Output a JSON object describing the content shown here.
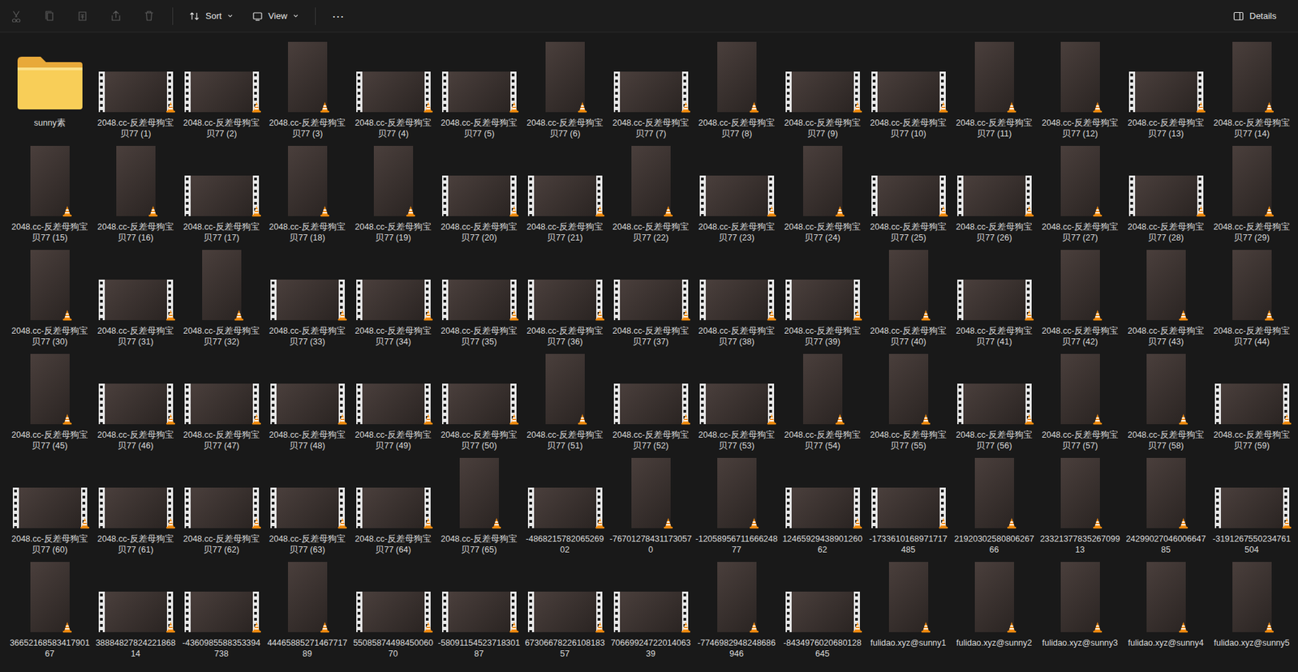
{
  "toolbar": {
    "actions": [
      {
        "disabled": true
      },
      {
        "disabled": true
      },
      {
        "disabled": true
      },
      {
        "disabled": true
      },
      {
        "disabled": true
      }
    ],
    "sort": {
      "label": "Sort"
    },
    "view": {
      "label": "View"
    },
    "more": "⋯",
    "details": {
      "label": "Details"
    }
  },
  "items": [
    {
      "name": "sunny素",
      "kind": "folder"
    },
    {
      "name": "2048.cc-反差母狗宝贝77 (1)",
      "kind": "landscape"
    },
    {
      "name": "2048.cc-反差母狗宝贝77 (2)",
      "kind": "landscape"
    },
    {
      "name": "2048.cc-反差母狗宝贝77 (3)",
      "kind": "portrait"
    },
    {
      "name": "2048.cc-反差母狗宝贝77 (4)",
      "kind": "landscape"
    },
    {
      "name": "2048.cc-反差母狗宝贝77 (5)",
      "kind": "landscape"
    },
    {
      "name": "2048.cc-反差母狗宝贝77 (6)",
      "kind": "portrait"
    },
    {
      "name": "2048.cc-反差母狗宝贝77 (7)",
      "kind": "landscape"
    },
    {
      "name": "2048.cc-反差母狗宝贝77 (8)",
      "kind": "portrait"
    },
    {
      "name": "2048.cc-反差母狗宝贝77 (9)",
      "kind": "landscape"
    },
    {
      "name": "2048.cc-反差母狗宝贝77 (10)",
      "kind": "landscape"
    },
    {
      "name": "2048.cc-反差母狗宝贝77 (11)",
      "kind": "portrait"
    },
    {
      "name": "2048.cc-反差母狗宝贝77 (12)",
      "kind": "portrait"
    },
    {
      "name": "2048.cc-反差母狗宝贝77 (13)",
      "kind": "landscape"
    },
    {
      "name": "2048.cc-反差母狗宝贝77 (14)",
      "kind": "portrait"
    },
    {
      "name": "2048.cc-反差母狗宝贝77 (15)",
      "kind": "portrait"
    },
    {
      "name": "2048.cc-反差母狗宝贝77 (16)",
      "kind": "portrait"
    },
    {
      "name": "2048.cc-反差母狗宝贝77 (17)",
      "kind": "landscape"
    },
    {
      "name": "2048.cc-反差母狗宝贝77 (18)",
      "kind": "portrait"
    },
    {
      "name": "2048.cc-反差母狗宝贝77 (19)",
      "kind": "portrait"
    },
    {
      "name": "2048.cc-反差母狗宝贝77 (20)",
      "kind": "landscape"
    },
    {
      "name": "2048.cc-反差母狗宝贝77 (21)",
      "kind": "landscape"
    },
    {
      "name": "2048.cc-反差母狗宝贝77 (22)",
      "kind": "portrait"
    },
    {
      "name": "2048.cc-反差母狗宝贝77 (23)",
      "kind": "landscape"
    },
    {
      "name": "2048.cc-反差母狗宝贝77 (24)",
      "kind": "portrait"
    },
    {
      "name": "2048.cc-反差母狗宝贝77 (25)",
      "kind": "landscape"
    },
    {
      "name": "2048.cc-反差母狗宝贝77 (26)",
      "kind": "landscape"
    },
    {
      "name": "2048.cc-反差母狗宝贝77 (27)",
      "kind": "portrait"
    },
    {
      "name": "2048.cc-反差母狗宝贝77 (28)",
      "kind": "landscape"
    },
    {
      "name": "2048.cc-反差母狗宝贝77 (29)",
      "kind": "portrait"
    },
    {
      "name": "2048.cc-反差母狗宝贝77 (30)",
      "kind": "portrait"
    },
    {
      "name": "2048.cc-反差母狗宝贝77 (31)",
      "kind": "landscape"
    },
    {
      "name": "2048.cc-反差母狗宝贝77 (32)",
      "kind": "portrait"
    },
    {
      "name": "2048.cc-反差母狗宝贝77 (33)",
      "kind": "landscape"
    },
    {
      "name": "2048.cc-反差母狗宝贝77 (34)",
      "kind": "landscape"
    },
    {
      "name": "2048.cc-反差母狗宝贝77 (35)",
      "kind": "landscape"
    },
    {
      "name": "2048.cc-反差母狗宝贝77 (36)",
      "kind": "landscape"
    },
    {
      "name": "2048.cc-反差母狗宝贝77 (37)",
      "kind": "landscape"
    },
    {
      "name": "2048.cc-反差母狗宝贝77 (38)",
      "kind": "landscape"
    },
    {
      "name": "2048.cc-反差母狗宝贝77 (39)",
      "kind": "landscape"
    },
    {
      "name": "2048.cc-反差母狗宝贝77 (40)",
      "kind": "portrait"
    },
    {
      "name": "2048.cc-反差母狗宝贝77 (41)",
      "kind": "landscape"
    },
    {
      "name": "2048.cc-反差母狗宝贝77 (42)",
      "kind": "portrait"
    },
    {
      "name": "2048.cc-反差母狗宝贝77 (43)",
      "kind": "portrait"
    },
    {
      "name": "2048.cc-反差母狗宝贝77 (44)",
      "kind": "portrait"
    },
    {
      "name": "2048.cc-反差母狗宝贝77 (45)",
      "kind": "portrait"
    },
    {
      "name": "2048.cc-反差母狗宝贝77 (46)",
      "kind": "landscape"
    },
    {
      "name": "2048.cc-反差母狗宝贝77 (47)",
      "kind": "landscape"
    },
    {
      "name": "2048.cc-反差母狗宝贝77 (48)",
      "kind": "landscape"
    },
    {
      "name": "2048.cc-反差母狗宝贝77 (49)",
      "kind": "landscape"
    },
    {
      "name": "2048.cc-反差母狗宝贝77 (50)",
      "kind": "landscape"
    },
    {
      "name": "2048.cc-反差母狗宝贝77 (51)",
      "kind": "portrait"
    },
    {
      "name": "2048.cc-反差母狗宝贝77 (52)",
      "kind": "landscape"
    },
    {
      "name": "2048.cc-反差母狗宝贝77 (53)",
      "kind": "landscape"
    },
    {
      "name": "2048.cc-反差母狗宝贝77 (54)",
      "kind": "portrait"
    },
    {
      "name": "2048.cc-反差母狗宝贝77 (55)",
      "kind": "portrait"
    },
    {
      "name": "2048.cc-反差母狗宝贝77 (56)",
      "kind": "landscape"
    },
    {
      "name": "2048.cc-反差母狗宝贝77 (57)",
      "kind": "portrait"
    },
    {
      "name": "2048.cc-反差母狗宝贝77 (58)",
      "kind": "portrait"
    },
    {
      "name": "2048.cc-反差母狗宝贝77 (59)",
      "kind": "landscape"
    },
    {
      "name": "2048.cc-反差母狗宝贝77 (60)",
      "kind": "landscape"
    },
    {
      "name": "2048.cc-反差母狗宝贝77 (61)",
      "kind": "landscape"
    },
    {
      "name": "2048.cc-反差母狗宝贝77 (62)",
      "kind": "landscape"
    },
    {
      "name": "2048.cc-反差母狗宝贝77 (63)",
      "kind": "landscape"
    },
    {
      "name": "2048.cc-反差母狗宝贝77 (64)",
      "kind": "landscape"
    },
    {
      "name": "2048.cc-反差母狗宝贝77 (65)",
      "kind": "portrait"
    },
    {
      "name": "-486821578206526902",
      "kind": "landscape"
    },
    {
      "name": "-767012784311730570",
      "kind": "portrait"
    },
    {
      "name": "-1205895671166624877",
      "kind": "portrait"
    },
    {
      "name": "1246592943890126062",
      "kind": "landscape"
    },
    {
      "name": "-1733610168971717485",
      "kind": "landscape"
    },
    {
      "name": "2192030258080626766",
      "kind": "portrait"
    },
    {
      "name": "2332137783526709913",
      "kind": "portrait"
    },
    {
      "name": "2429902704600664785",
      "kind": "portrait"
    },
    {
      "name": "-3191267550234761504",
      "kind": "landscape"
    },
    {
      "name": "3665216858341790167",
      "kind": "portrait"
    },
    {
      "name": "3888482782422186814",
      "kind": "landscape"
    },
    {
      "name": "-4360985588353394738",
      "kind": "landscape"
    },
    {
      "name": "4446588527146771789",
      "kind": "portrait"
    },
    {
      "name": "5508587449845006070",
      "kind": "landscape"
    },
    {
      "name": "-5809115452371830187",
      "kind": "landscape"
    },
    {
      "name": "6730667822610818357",
      "kind": "landscape"
    },
    {
      "name": "7066992472201406339",
      "kind": "landscape"
    },
    {
      "name": "-7746982948248686946",
      "kind": "portrait"
    },
    {
      "name": "-8434976020680128645",
      "kind": "landscape"
    },
    {
      "name": "fulidao.xyz@sunny1",
      "kind": "portrait"
    },
    {
      "name": "fulidao.xyz@sunny2",
      "kind": "portrait"
    },
    {
      "name": "fulidao.xyz@sunny3",
      "kind": "portrait"
    },
    {
      "name": "fulidao.xyz@sunny4",
      "kind": "portrait"
    },
    {
      "name": "fulidao.xyz@sunny5",
      "kind": "portrait"
    }
  ]
}
